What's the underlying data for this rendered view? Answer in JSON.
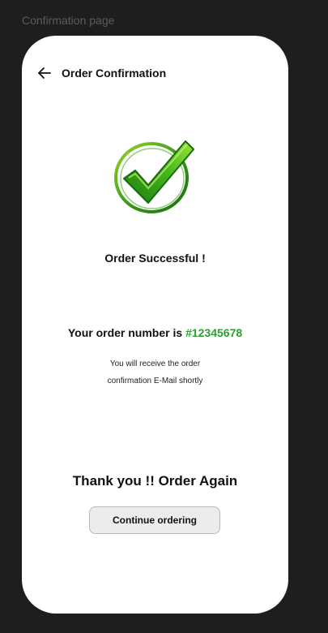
{
  "frame": {
    "label": "Confirmation page"
  },
  "header": {
    "title": "Order Confirmation",
    "back_icon": "arrow-left-icon"
  },
  "status": {
    "icon": "success-checkmark-icon",
    "title": "Order Successful !",
    "accent_color": "#2aa12f"
  },
  "order": {
    "number_prefix": "Your order number is",
    "number": "#12345678",
    "note_line1": "You will receive the order",
    "note_line2": "confirmation E-Mail shortly"
  },
  "footer": {
    "thanks": "Thank you !! Order Again",
    "continue_label": "Continue ordering"
  }
}
